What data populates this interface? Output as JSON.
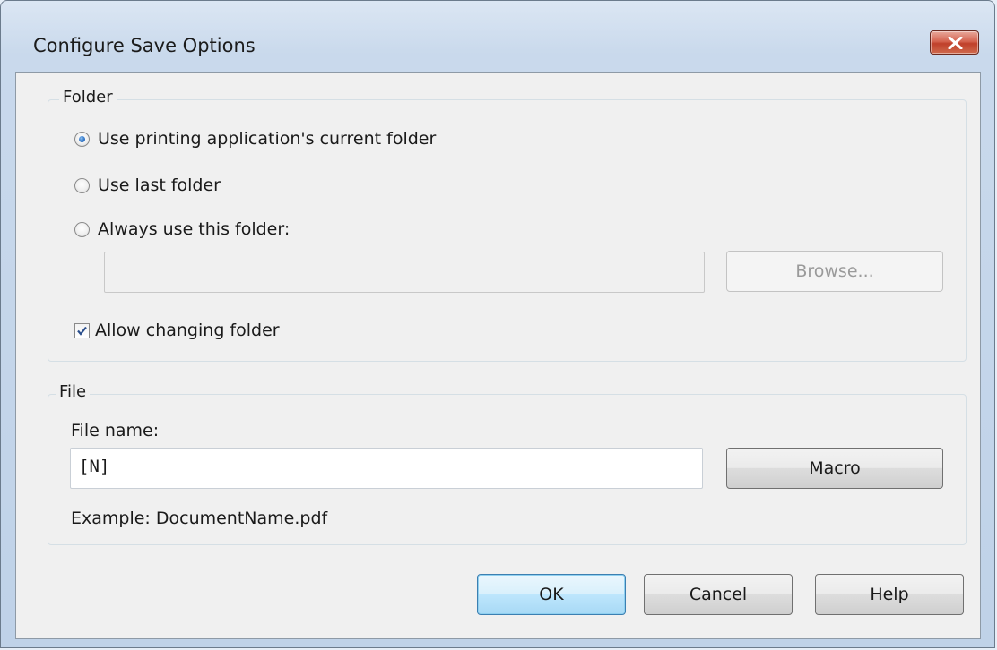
{
  "window": {
    "title": "Configure Save Options",
    "close_icon": "close-x-icon"
  },
  "folder": {
    "legend": "Folder",
    "options": [
      {
        "label": "Use printing application's current folder",
        "checked": true
      },
      {
        "label": "Use last folder",
        "checked": false
      },
      {
        "label": "Always use this folder:",
        "checked": false
      }
    ],
    "path_value": "",
    "browse_label": "Browse...",
    "allow_change_label": "Allow changing folder",
    "allow_change_checked": true
  },
  "file": {
    "legend": "File",
    "name_label": "File name:",
    "name_value": "[N]",
    "macro_label": "Macro",
    "example_text": "Example: DocumentName.pdf"
  },
  "buttons": {
    "ok": "OK",
    "cancel": "Cancel",
    "help": "Help"
  },
  "colors": {
    "close_button": "#c7432e",
    "default_button_border": "#3c7fb1",
    "radio_selected": "#2a6fc4"
  }
}
